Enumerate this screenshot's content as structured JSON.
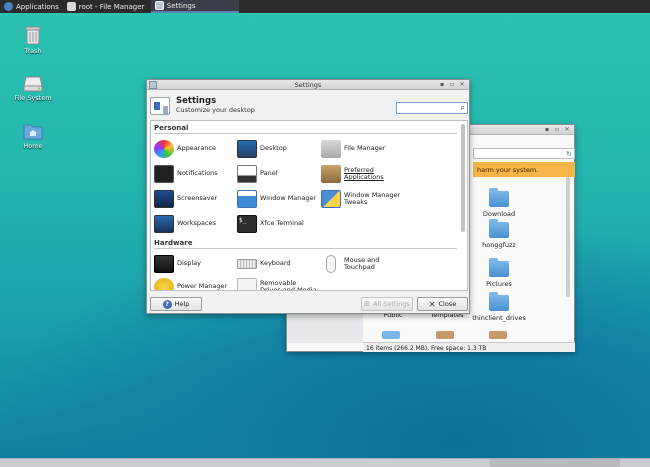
{
  "taskbar": {
    "applications_label": "Applications",
    "file_manager_task": "root - File Manager",
    "settings_task": "Settings"
  },
  "desktop": {
    "icons": [
      {
        "label": "Trash",
        "icon": "trash-icon"
      },
      {
        "label": "File System",
        "icon": "drive-icon"
      },
      {
        "label": "Home",
        "icon": "home-folder-icon"
      }
    ]
  },
  "settings": {
    "window_title": "Settings",
    "heading": "Settings",
    "subheading": "Customize your desktop",
    "search_placeholder": "",
    "sections": [
      {
        "name": "Personal",
        "items": [
          "Appearance",
          "Desktop",
          "File Manager",
          "Notifications",
          "Panel",
          "Preferred Applications",
          "Screensaver",
          "Window Manager",
          "Window Manager Tweaks",
          "Workspaces",
          "Xfce Terminal"
        ]
      },
      {
        "name": "Hardware",
        "items": [
          "Display",
          "Keyboard",
          "Mouse and Touchpad",
          "Power Manager",
          "Removable Drives and Media"
        ]
      }
    ],
    "help_label": "Help",
    "all_settings_label": "All Settings",
    "close_label": "Close",
    "colors": {
      "accent": "#3d6fb8"
    }
  },
  "file_manager": {
    "warning_text": "harm your system.",
    "items": [
      "Download",
      "honggfuzz",
      "Pictures",
      "thinclient_drives",
      "Public",
      "Templates"
    ],
    "status": "16 items (266.2 MB), Free space: 1.3 TB"
  }
}
